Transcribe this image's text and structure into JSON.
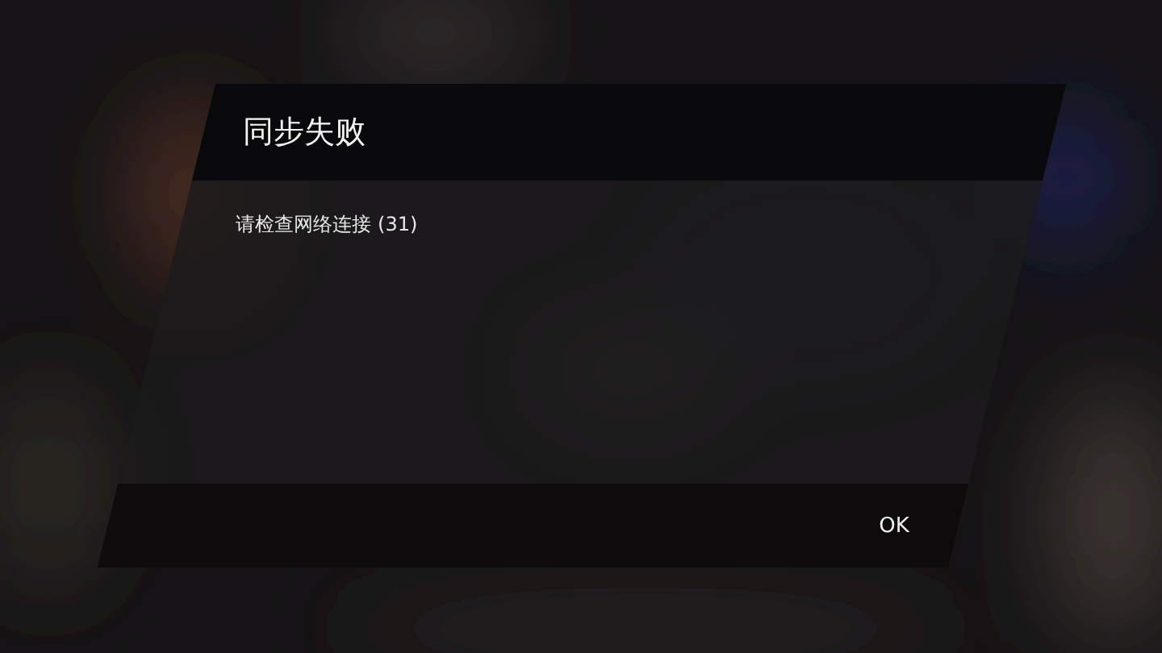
{
  "dialog": {
    "title": "同步失败",
    "message": "请检查网络连接 (31)",
    "buttons": [
      {
        "label": "OK"
      }
    ]
  }
}
